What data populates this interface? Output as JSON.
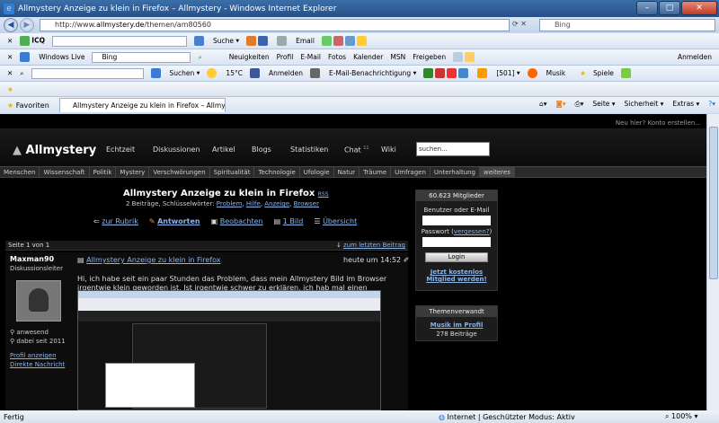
{
  "window": {
    "title": "Allmystery Anzeige zu klein in Firefox – Allmystery - Windows Internet Explorer"
  },
  "nav": {
    "url_prefix": "http://www.",
    "url_domain": "allmystery.de",
    "url_path": "/themen/am80560",
    "search_placeholder": "Bing"
  },
  "toolbar1": {
    "icq": "ICQ",
    "suche": "Suche",
    "email": "Email"
  },
  "toolbar2": {
    "windows_live": "Windows Live",
    "bing": "Bing",
    "items": [
      "Neuigkeiten",
      "Profil",
      "E-Mail",
      "Fotos",
      "Kalender",
      "MSN",
      "Freigeben"
    ],
    "anmelden": "Anmelden"
  },
  "toolbar3": {
    "suchen": "Suchen",
    "temp": "15°C",
    "anmelden": "Anmelden",
    "email_notify": "E-Mail-Benachrichtigung",
    "count": "[501]",
    "musik": "Musik",
    "spiele": "Spiele"
  },
  "favbar": {
    "favoriten": "Favoriten",
    "tab_title": "Allmystery Anzeige zu klein in Firefox – Allmystery",
    "tools": [
      "Seite",
      "Sicherheit",
      "Extras"
    ]
  },
  "site": {
    "top_link": "Neu hier? Konto erstellen...",
    "logo": "Allmystery",
    "nav": [
      "Echtzeit",
      "Diskussionen",
      "Artikel",
      "Blogs",
      "Statistiken",
      "Chat",
      "Wiki"
    ],
    "chat_count": "11",
    "search_placeholder": "suchen...",
    "categories": [
      "Menschen",
      "Wissenschaft",
      "Politik",
      "Mystery",
      "Verschwörungen",
      "Spiritualität",
      "Technologie",
      "Ufologie",
      "Natur",
      "Träume",
      "Umfragen",
      "Unterhaltung",
      "weiteres"
    ],
    "thread_title": "Allmystery Anzeige zu klein in Firefox",
    "rss": "RSS",
    "meta_prefix": "2 Beiträge, Schlüsselwörter:",
    "keywords": [
      "Problem",
      "Hilfe",
      "Anzeige",
      "Browser"
    ],
    "actions": [
      "zur Rubrik",
      "Antworten",
      "Beobachten",
      "1 Bild",
      "Übersicht"
    ],
    "page_info": "Seite 1 von 1",
    "last_post_link": "zum letzten Beitrag",
    "post": {
      "author": "Maxman90",
      "role": "Diskussionsleiter",
      "status": "anwesend",
      "since": "dabei seit 2011",
      "profile_link": "Profil anzeigen",
      "message_link": "Direkte Nachricht",
      "title": "Allmystery Anzeige zu klein in Firefox",
      "time": "heute um 14:52",
      "text": "Hi, ich habe seit ein paar Stunden das Problem, dass mein Allmystery Bild im Browser irgentwie klein geworden ist. Ist irgentwie schwer zu erklären, ich hab mal einen Screenshot gemacht :"
    },
    "sidebar": {
      "members": "60.623 Mitglieder",
      "user_label": "Benutzer oder E-Mail",
      "pass_label": "Passwort",
      "forgot": "vergessen?",
      "login": "Login",
      "signup": "Jetzt kostenlos Mitglied werden!",
      "related_head": "Themenverwandt",
      "related_link": "Musik im Profil",
      "related_count": "278 Beiträge"
    }
  },
  "status": {
    "left": "Fertig",
    "zone": "Internet | Geschützter Modus: Aktiv",
    "zoom": "100%"
  }
}
